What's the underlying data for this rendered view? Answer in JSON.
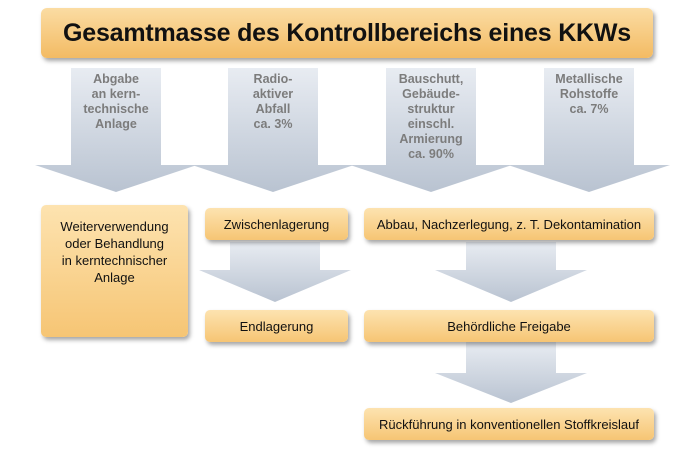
{
  "title": "Gesamtmasse des Kontrollbereichs eines KKWs",
  "columns": [
    {
      "lines": [
        "Abgabe",
        "an kern-",
        "technische",
        "Anlage"
      ]
    },
    {
      "lines": [
        "Radio-",
        "aktiver",
        "Abfall",
        "ca. 3%"
      ]
    },
    {
      "lines": [
        "Bauschutt,",
        "Gebäude-",
        "struktur",
        "einschl.",
        "Armierung",
        "ca. 90%"
      ]
    },
    {
      "lines": [
        "Metallische",
        "Rohstoffe",
        "ca. 7%"
      ]
    }
  ],
  "boxes": {
    "weiterverwendung": [
      "Weiterverwendung",
      "oder Behandlung",
      "in kerntechnischer",
      "Anlage"
    ],
    "zwischenlagerung": "Zwischenlagerung",
    "endlagerung": "Endlagerung",
    "abbau": "Abbau, Nachzerlegung, z. T. Dekontamination",
    "freigabe": "Behördliche Freigabe",
    "rueckfuehrung": "Rückführung in konventionellen Stoffkreislauf"
  },
  "colors": {
    "box_light": "#fde3b0",
    "box_dark": "#f6c574",
    "arrow_light": "#dde3ec",
    "arrow_dark": "#b9c3d1"
  }
}
